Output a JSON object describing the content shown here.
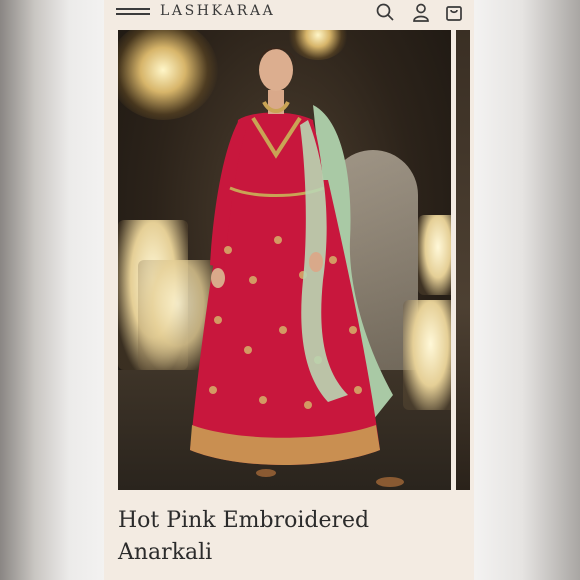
{
  "header": {
    "brand": "LASHKARAA",
    "icons": {
      "menu": "hamburger-menu-icon",
      "search": "search-icon",
      "account": "user-icon",
      "cart": "shopping-bag-icon"
    }
  },
  "product": {
    "title_line1": "Hot Pink Embroidered",
    "title_line2": "Anarkali",
    "image_alt": "Model wearing a hot pink embroidered anarkali with mint dupatta",
    "colors": {
      "dress": "#c8173d",
      "dupatta": "#a9c9a5",
      "embroidery": "#c9a455"
    }
  },
  "theme": {
    "page_bg": "#f3ebe2",
    "text": "#2b2b2b"
  }
}
